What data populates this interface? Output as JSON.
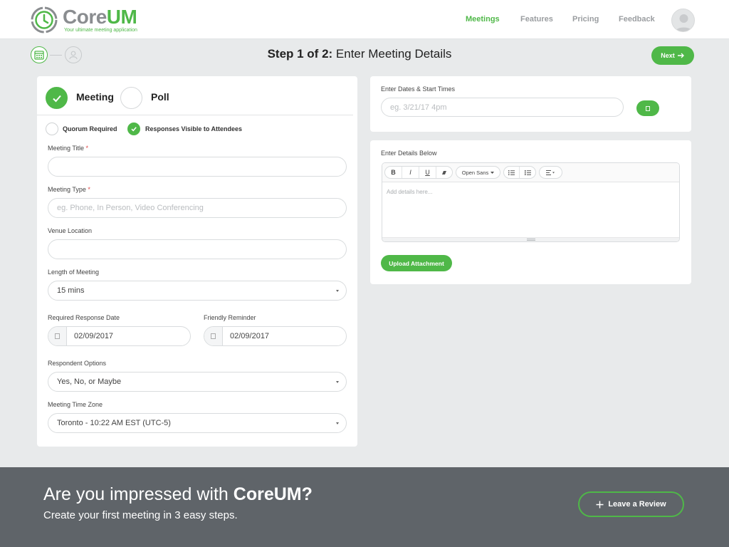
{
  "brand": {
    "name_part1": "Core",
    "name_part2": "UM",
    "tagline": "Your ultimate meeting application",
    "accent": "#4fb848"
  },
  "nav": {
    "items": [
      {
        "label": "Meetings",
        "active": true
      },
      {
        "label": "Features"
      },
      {
        "label": "Pricing"
      },
      {
        "label": "Feedback"
      }
    ]
  },
  "steps": {
    "title_bold": "Step 1 of 2:",
    "title_rest": " Enter Meeting Details",
    "next_label": "Next"
  },
  "form": {
    "type_meeting": "Meeting",
    "type_poll": "Poll",
    "quorum_label": "Quorum Required",
    "responses_label": "Responses Visible to Attendees",
    "title_label": "Meeting Title",
    "type_label": "Meeting Type",
    "type_placeholder": "eg. Phone, In Person, Video Conferencing",
    "venue_label": "Venue Location",
    "length_label": "Length of Meeting",
    "length_value": "15 mins",
    "response_date_label": "Required Response Date",
    "response_date_value": "02/09/2017",
    "reminder_label": "Friendly Reminder",
    "reminder_value": "02/09/2017",
    "respondent_label": "Respondent Options",
    "respondent_value": "Yes, No, or Maybe",
    "timezone_label": "Meeting Time Zone",
    "timezone_value": "Toronto - 10:22 AM EST (UTC-5)",
    "required_mark": "*"
  },
  "dates": {
    "label": "Enter Dates & Start Times",
    "placeholder": "eg. 3/21/17 4pm"
  },
  "details": {
    "label": "Enter Details Below",
    "bold": "B",
    "italic": "I",
    "underline": "U",
    "font": "Open Sans",
    "placeholder": "Add details here...",
    "upload_label": "Upload Attachment"
  },
  "footer": {
    "title_part1": "Are you impressed with ",
    "title_part2": "CoreUM?",
    "subtitle": "Create your first meeting in 3 easy steps.",
    "review_label": "Leave a Review"
  }
}
